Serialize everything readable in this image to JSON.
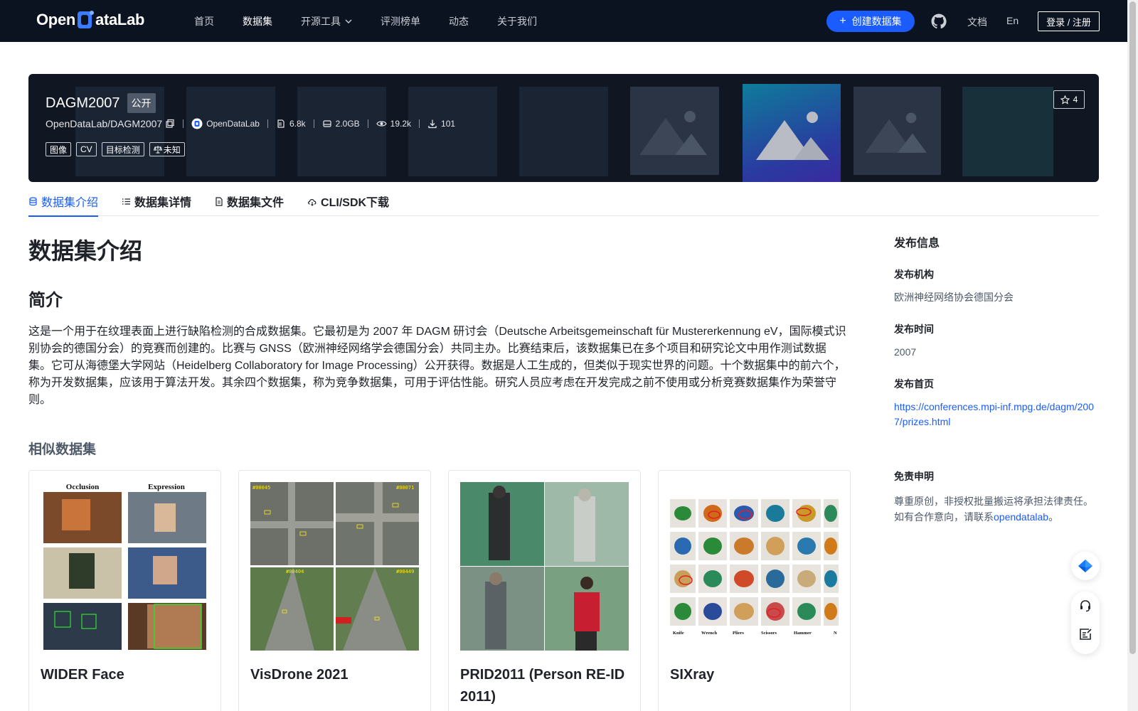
{
  "nav": {
    "logo_left": "Open",
    "logo_right": "ataLab",
    "links": [
      {
        "label": "首页",
        "active": false
      },
      {
        "label": "数据集",
        "active": true
      },
      {
        "label": "开源工具",
        "active": false
      },
      {
        "label": "评测榜单",
        "active": false
      },
      {
        "label": "动态",
        "active": false
      },
      {
        "label": "关于我们",
        "active": false
      }
    ],
    "create_label": "创建数据集",
    "docs_label": "文档",
    "lang_label": "En",
    "login_label": "登录 / 注册"
  },
  "dataset": {
    "title": "DAGM2007",
    "visibility": "公开",
    "repo": "OpenDataLab/DAGM2007",
    "owner": "OpenDataLab",
    "stats": {
      "files": "6.8k",
      "size": "2.0GB",
      "views": "19.2k",
      "downloads": "101"
    },
    "tags": [
      "图像",
      "CV",
      "目标检测",
      "未知"
    ],
    "stars": "4"
  },
  "tabs": [
    {
      "label": "数据集介绍",
      "icon": "database-icon"
    },
    {
      "label": "数据集详情",
      "icon": "list-icon"
    },
    {
      "label": "数据集文件",
      "icon": "file-icon"
    },
    {
      "label": "CLI/SDK下载",
      "icon": "cloud-icon"
    }
  ],
  "content": {
    "heading": "数据集介绍",
    "subheading": "简介",
    "intro": "这是一个用于在纹理表面上进行缺陷检测的合成数据集。它最初是为 2007 年 DAGM 研讨会（Deutsche Arbeitsgemeinschaft für Mustererkennung eV，国际模式识别协会的德国分会）的竞赛而创建的。比赛与 GNSS（欧洲神经网络学会德国分会）共同主办。比赛结束后，该数据集已在多个项目和研究论文中用作测试数据集。它可从海德堡大学网站（Heidelberg Collaboratory for Image Processing）公开获得。数据是人工生成的，但类似于现实世界的问题。十个数据集中的前六个，称为开发数据集，应该用于算法开发。其余四个数据集，称为竞争数据集，可用于评估性能。研究人员应考虑在开发完成之前不使用或分析竞赛数据集作为荣誉守则。",
    "similar_title": "相似数据集",
    "similar": [
      {
        "name": "WIDER Face",
        "thumb_labels": [
          "Occlusion",
          "Expression"
        ]
      },
      {
        "name": "VisDrone 2021",
        "thumb_labels": [
          "#00045",
          "#00071",
          "#00404",
          "#00449"
        ]
      },
      {
        "name": "PRID2011 (Person RE-ID 2011)",
        "thumb_labels": []
      },
      {
        "name": "SIXray",
        "thumb_labels": [
          "Knife",
          "Wrench",
          "Pliers",
          "Scissors",
          "Hammer",
          "N"
        ]
      }
    ]
  },
  "side": {
    "title": "发布信息",
    "org_label": "发布机构",
    "org_value": "欧洲神经网络协会德国分会",
    "date_label": "发布时间",
    "date_value": "2007",
    "home_label": "发布首页",
    "home_value": "https://conferences.mpi-inf.mpg.de/dagm/2007/prizes.html",
    "disclaimer_label": "免责申明",
    "disclaimer_line1": "尊重原创，非授权批量搬运将承担法律责任。",
    "disclaimer_line2": "如有合作意向，请联系",
    "disclaimer_link": "opendatalab",
    "disclaimer_end": "。"
  },
  "colors": {
    "accent": "#1a5cff",
    "nav_bg": "#0b1220",
    "banner_bg": "#111722"
  }
}
